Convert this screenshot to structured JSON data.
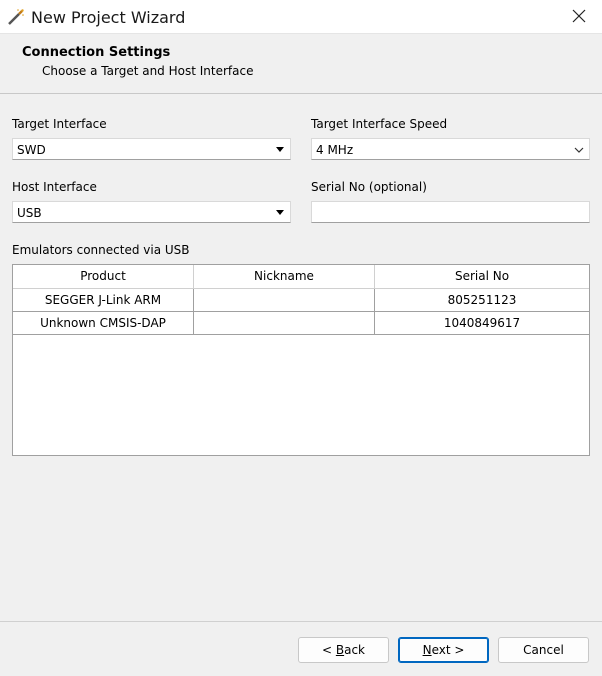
{
  "window": {
    "title": "New Project Wizard"
  },
  "header": {
    "title": "Connection Settings",
    "subtitle": "Choose a Target and Host Interface"
  },
  "form": {
    "target_interface": {
      "label": "Target Interface",
      "value": "SWD"
    },
    "target_interface_speed": {
      "label": "Target Interface Speed",
      "value": "4 MHz"
    },
    "host_interface": {
      "label": "Host Interface",
      "value": "USB"
    },
    "serial_no": {
      "label": "Serial No (optional)",
      "value": ""
    }
  },
  "emulators": {
    "label": "Emulators connected via USB",
    "columns": [
      "Product",
      "Nickname",
      "Serial No"
    ],
    "rows": [
      [
        "SEGGER J-Link ARM",
        "",
        "805251123"
      ],
      [
        "Unknown CMSIS-DAP",
        "",
        "1040849617"
      ]
    ]
  },
  "buttons": {
    "back_prefix": "< ",
    "back_key": "B",
    "back_rest": "ack",
    "next_key": "N",
    "next_rest": "ext >",
    "cancel": "Cancel"
  },
  "colors": {
    "accent": "#0067c0",
    "window_bg": "#f0f0f0"
  },
  "icons": {
    "app": "magic-wand-icon",
    "close": "close-icon",
    "dropdown": "chevron-down-icon"
  }
}
